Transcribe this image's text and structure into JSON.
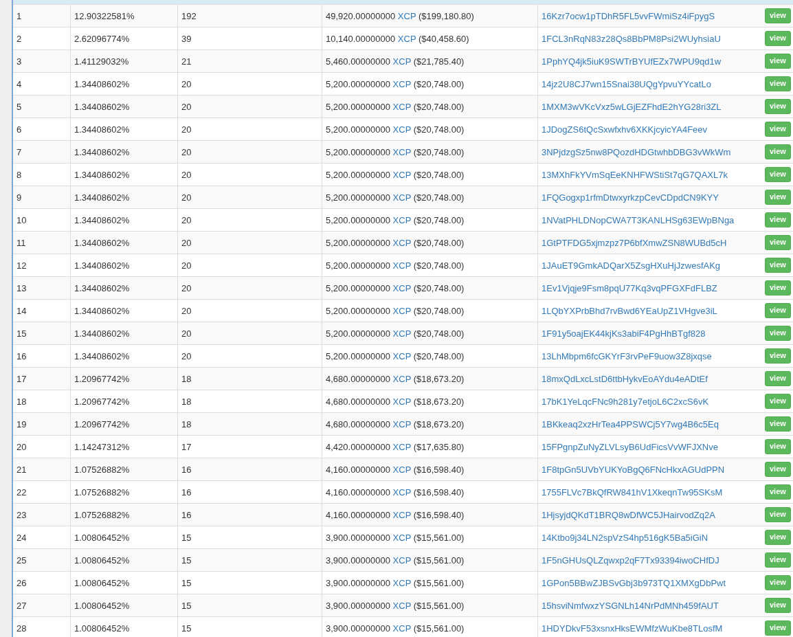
{
  "rows": [
    {
      "rank": "1",
      "percent": "12.90322581%",
      "count": "192",
      "amount": "49,920.00000000",
      "asset": "XCP",
      "usd": "($199,180.80)",
      "address": "16Kzr7ocw1pTDhR5FL5vvFWmiSz4iFpygS",
      "action": "view"
    },
    {
      "rank": "2",
      "percent": "2.62096774%",
      "count": "39",
      "amount": "10,140.00000000",
      "asset": "XCP",
      "usd": "($40,458.60)",
      "address": "1FCL3nRqN83z28Qs8BbPM8Psi2WUyhsiaU",
      "action": "view"
    },
    {
      "rank": "3",
      "percent": "1.41129032%",
      "count": "21",
      "amount": "5,460.00000000",
      "asset": "XCP",
      "usd": "($21,785.40)",
      "address": "1PphYQ4jk5iuK9SWTrBYUfEZx7WPU9qd1w",
      "action": "view"
    },
    {
      "rank": "4",
      "percent": "1.34408602%",
      "count": "20",
      "amount": "5,200.00000000",
      "asset": "XCP",
      "usd": "($20,748.00)",
      "address": "14jz2U8CJ7wn15Snai38UQgYpvuYYcatLo",
      "action": "view"
    },
    {
      "rank": "5",
      "percent": "1.34408602%",
      "count": "20",
      "amount": "5,200.00000000",
      "asset": "XCP",
      "usd": "($20,748.00)",
      "address": "1MXM3wVKcVxz5wLGjEZFhdE2hYG28ri3ZL",
      "action": "view"
    },
    {
      "rank": "6",
      "percent": "1.34408602%",
      "count": "20",
      "amount": "5,200.00000000",
      "asset": "XCP",
      "usd": "($20,748.00)",
      "address": "1JDogZS6tQcSxwfxhv6XKKjcyicYA4Feev",
      "action": "view"
    },
    {
      "rank": "7",
      "percent": "1.34408602%",
      "count": "20",
      "amount": "5,200.00000000",
      "asset": "XCP",
      "usd": "($20,748.00)",
      "address": "3NPjdzgSz5nw8PQozdHDGtwhbDBG3vWkWm",
      "action": "view"
    },
    {
      "rank": "8",
      "percent": "1.34408602%",
      "count": "20",
      "amount": "5,200.00000000",
      "asset": "XCP",
      "usd": "($20,748.00)",
      "address": "13MXhFkYVmSqEeKNHFWStiSt7qG7QAXL7k",
      "action": "view"
    },
    {
      "rank": "9",
      "percent": "1.34408602%",
      "count": "20",
      "amount": "5,200.00000000",
      "asset": "XCP",
      "usd": "($20,748.00)",
      "address": "1FQGogxp1rfmDtwxyrkzpCevCDpdCN9KYY",
      "action": "view"
    },
    {
      "rank": "10",
      "percent": "1.34408602%",
      "count": "20",
      "amount": "5,200.00000000",
      "asset": "XCP",
      "usd": "($20,748.00)",
      "address": "1NVatPHLDNopCWA7T3KANLHSg63EWpBNga",
      "action": "view"
    },
    {
      "rank": "11",
      "percent": "1.34408602%",
      "count": "20",
      "amount": "5,200.00000000",
      "asset": "XCP",
      "usd": "($20,748.00)",
      "address": "1GtPTFDG5xjmzpz7P6bfXmwZSN8WUBd5cH",
      "action": "view"
    },
    {
      "rank": "12",
      "percent": "1.34408602%",
      "count": "20",
      "amount": "5,200.00000000",
      "asset": "XCP",
      "usd": "($20,748.00)",
      "address": "1JAuET9GmkADQarX5ZsgHXuHjJzwesfAKg",
      "action": "view"
    },
    {
      "rank": "13",
      "percent": "1.34408602%",
      "count": "20",
      "amount": "5,200.00000000",
      "asset": "XCP",
      "usd": "($20,748.00)",
      "address": "1Ev1Vjqje9Fsm8pqU77Kq3vqPFGXFdFLBZ",
      "action": "view"
    },
    {
      "rank": "14",
      "percent": "1.34408602%",
      "count": "20",
      "amount": "5,200.00000000",
      "asset": "XCP",
      "usd": "($20,748.00)",
      "address": "1LQbYXPrbBhd7rvBwd6YEaUpZ1VHgve3iL",
      "action": "view"
    },
    {
      "rank": "15",
      "percent": "1.34408602%",
      "count": "20",
      "amount": "5,200.00000000",
      "asset": "XCP",
      "usd": "($20,748.00)",
      "address": "1F91y5oajEK44kjKs3abiF4PgHhBTgf828",
      "action": "view"
    },
    {
      "rank": "16",
      "percent": "1.34408602%",
      "count": "20",
      "amount": "5,200.00000000",
      "asset": "XCP",
      "usd": "($20,748.00)",
      "address": "13LhMbpm6fcGKYrF3rvPeF9uow3Z8jxqse",
      "action": "view"
    },
    {
      "rank": "17",
      "percent": "1.20967742%",
      "count": "18",
      "amount": "4,680.00000000",
      "asset": "XCP",
      "usd": "($18,673.20)",
      "address": "18mxQdLxcLstD6ttbHykvEoAYdu4eADtEf",
      "action": "view"
    },
    {
      "rank": "18",
      "percent": "1.20967742%",
      "count": "18",
      "amount": "4,680.00000000",
      "asset": "XCP",
      "usd": "($18,673.20)",
      "address": "17bK1YeLqcFNc9h281y7etjoL6C2xcS6vK",
      "action": "view"
    },
    {
      "rank": "19",
      "percent": "1.20967742%",
      "count": "18",
      "amount": "4,680.00000000",
      "asset": "XCP",
      "usd": "($18,673.20)",
      "address": "1BKkeaq2xzHrTea4PPSWCj5Y7wg4B6c5Eq",
      "action": "view"
    },
    {
      "rank": "20",
      "percent": "1.14247312%",
      "count": "17",
      "amount": "4,420.00000000",
      "asset": "XCP",
      "usd": "($17,635.80)",
      "address": "15FPgnpZuNyZLVLsyB6UdFicsVvWFJXNve",
      "action": "view"
    },
    {
      "rank": "21",
      "percent": "1.07526882%",
      "count": "16",
      "amount": "4,160.00000000",
      "asset": "XCP",
      "usd": "($16,598.40)",
      "address": "1F8tpGn5UVbYUKYoBgQ6FNcHkxAGUdPPN",
      "action": "view"
    },
    {
      "rank": "22",
      "percent": "1.07526882%",
      "count": "16",
      "amount": "4,160.00000000",
      "asset": "XCP",
      "usd": "($16,598.40)",
      "address": "1755FLVc7BkQfRW841hV1XkeqnTw95SKsM",
      "action": "view"
    },
    {
      "rank": "23",
      "percent": "1.07526882%",
      "count": "16",
      "amount": "4,160.00000000",
      "asset": "XCP",
      "usd": "($16,598.40)",
      "address": "1HjsyjdQKdT1BRQ8wDfWC5JHairvodZq2A",
      "action": "view"
    },
    {
      "rank": "24",
      "percent": "1.00806452%",
      "count": "15",
      "amount": "3,900.00000000",
      "asset": "XCP",
      "usd": "($15,561.00)",
      "address": "14Ktbo9j34LN2spVzS4hp516gK5Ba5iGiN",
      "action": "view"
    },
    {
      "rank": "25",
      "percent": "1.00806452%",
      "count": "15",
      "amount": "3,900.00000000",
      "asset": "XCP",
      "usd": "($15,561.00)",
      "address": "1F5nGHUsQLZqwxp2qF7Tx93394iwoCHfDJ",
      "action": "view"
    },
    {
      "rank": "26",
      "percent": "1.00806452%",
      "count": "15",
      "amount": "3,900.00000000",
      "asset": "XCP",
      "usd": "($15,561.00)",
      "address": "1GPon5BBwZJBSvGbj3b973TQ1XMXgDbPwt",
      "action": "view"
    },
    {
      "rank": "27",
      "percent": "1.00806452%",
      "count": "15",
      "amount": "3,900.00000000",
      "asset": "XCP",
      "usd": "($15,561.00)",
      "address": "15hsviNmfwxzYSGNLh14NrPdMNh459fAUT",
      "action": "view"
    },
    {
      "rank": "28",
      "percent": "1.00806452%",
      "count": "15",
      "amount": "3,900.00000000",
      "asset": "XCP",
      "usd": "($15,561.00)",
      "address": "1HDYDkvF53xsnxHksEWMfzWuKbe8TLosfM",
      "action": "view"
    }
  ]
}
